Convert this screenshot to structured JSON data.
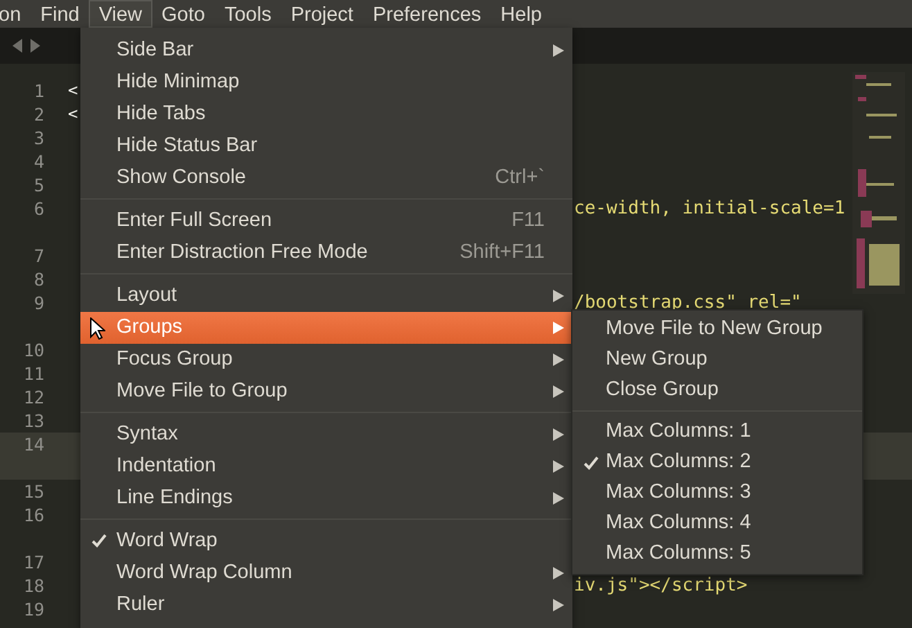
{
  "menubar": [
    {
      "label": "on",
      "selected": false
    },
    {
      "label": "Find",
      "selected": false
    },
    {
      "label": "View",
      "selected": true
    },
    {
      "label": "Goto",
      "selected": false
    },
    {
      "label": "Tools",
      "selected": false
    },
    {
      "label": "Project",
      "selected": false
    },
    {
      "label": "Preferences",
      "selected": false
    },
    {
      "label": "Help",
      "selected": false
    }
  ],
  "editor": {
    "lines": [
      {
        "number": "1",
        "code": "<",
        "kind": "head",
        "wrapped": false,
        "current": false
      },
      {
        "number": "2",
        "code": "<",
        "kind": "head",
        "wrapped": false,
        "current": false
      },
      {
        "number": "3",
        "wrapped": false,
        "current": false
      },
      {
        "number": "4",
        "wrapped": false,
        "current": false
      },
      {
        "number": "5",
        "wrapped": false,
        "current": false
      },
      {
        "number": "6",
        "code": "ce-width, initial-scale=1",
        "kind": "tail",
        "wrapped": true,
        "current": false
      },
      {
        "number": "7",
        "wrapped": false,
        "current": false
      },
      {
        "number": "8",
        "wrapped": false,
        "current": false
      },
      {
        "number": "9",
        "code": "/bootstrap.css\" rel=\"",
        "kind": "tail",
        "wrapped": true,
        "current": false
      },
      {
        "number": "10",
        "wrapped": false,
        "current": false
      },
      {
        "number": "11",
        "wrapped": false,
        "current": false
      },
      {
        "number": "12",
        "wrapped": false,
        "current": false
      },
      {
        "number": "13",
        "wrapped": false,
        "current": false
      },
      {
        "number": "14",
        "wrapped": true,
        "current": true
      },
      {
        "number": "15",
        "wrapped": false,
        "current": false
      },
      {
        "number": "16",
        "wrapped": true,
        "current": false
      },
      {
        "number": "17",
        "wrapped": false,
        "current": false
      },
      {
        "number": "18",
        "code": "iv.js\"></script>",
        "kind": "tail",
        "wrapped": false,
        "current": false
      },
      {
        "number": "19",
        "wrapped": false,
        "current": false
      }
    ]
  },
  "view_menu": [
    {
      "kind": "item",
      "label": "Side Bar",
      "submenu": true,
      "checked": false,
      "selected": false
    },
    {
      "kind": "item",
      "label": "Hide Minimap",
      "submenu": false,
      "checked": false,
      "selected": false
    },
    {
      "kind": "item",
      "label": "Hide Tabs",
      "submenu": false,
      "checked": false,
      "selected": false
    },
    {
      "kind": "item",
      "label": "Hide Status Bar",
      "submenu": false,
      "checked": false,
      "selected": false
    },
    {
      "kind": "item",
      "label": "Show Console",
      "shortcut": "Ctrl+`",
      "submenu": false,
      "checked": false,
      "selected": false
    },
    {
      "kind": "separator"
    },
    {
      "kind": "item",
      "label": "Enter Full Screen",
      "shortcut": "F11",
      "submenu": false,
      "checked": false,
      "selected": false
    },
    {
      "kind": "item",
      "label": "Enter Distraction Free Mode",
      "shortcut": "Shift+F11",
      "submenu": false,
      "checked": false,
      "selected": false
    },
    {
      "kind": "separator"
    },
    {
      "kind": "item",
      "label": "Layout",
      "submenu": true,
      "checked": false,
      "selected": false
    },
    {
      "kind": "item",
      "label": "Groups",
      "submenu": true,
      "checked": false,
      "selected": true
    },
    {
      "kind": "item",
      "label": "Focus Group",
      "submenu": true,
      "checked": false,
      "selected": false
    },
    {
      "kind": "item",
      "label": "Move File to Group",
      "submenu": true,
      "checked": false,
      "selected": false
    },
    {
      "kind": "separator"
    },
    {
      "kind": "item",
      "label": "Syntax",
      "submenu": true,
      "checked": false,
      "selected": false
    },
    {
      "kind": "item",
      "label": "Indentation",
      "submenu": true,
      "checked": false,
      "selected": false
    },
    {
      "kind": "item",
      "label": "Line Endings",
      "submenu": true,
      "checked": false,
      "selected": false
    },
    {
      "kind": "separator"
    },
    {
      "kind": "item",
      "label": "Word Wrap",
      "submenu": false,
      "checked": true,
      "selected": false
    },
    {
      "kind": "item",
      "label": "Word Wrap Column",
      "submenu": true,
      "checked": false,
      "selected": false
    },
    {
      "kind": "item",
      "label": "Ruler",
      "submenu": true,
      "checked": false,
      "selected": false
    }
  ],
  "groups_submenu": [
    {
      "kind": "item",
      "label": "Move File to New Group",
      "checked": false
    },
    {
      "kind": "item",
      "label": "New Group",
      "checked": false
    },
    {
      "kind": "item",
      "label": "Close Group",
      "checked": false
    },
    {
      "kind": "separator"
    },
    {
      "kind": "item",
      "label": "Max Columns: 1",
      "checked": false
    },
    {
      "kind": "item",
      "label": "Max Columns: 2",
      "checked": true
    },
    {
      "kind": "item",
      "label": "Max Columns: 3",
      "checked": false
    },
    {
      "kind": "item",
      "label": "Max Columns: 4",
      "checked": false
    },
    {
      "kind": "item",
      "label": "Max Columns: 5",
      "checked": false
    }
  ]
}
